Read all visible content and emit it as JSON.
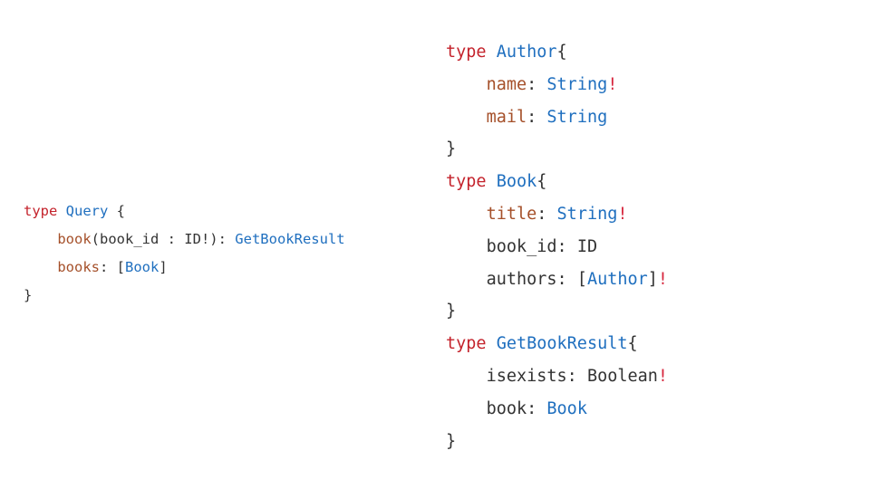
{
  "colors": {
    "keyword": "#c4232c",
    "type": "#1f6fbf",
    "field": "#a5502a",
    "bang": "#d7263d",
    "punct": "#333333",
    "background": "#ffffff"
  },
  "query": {
    "lines": [
      [
        {
          "text": "type",
          "cls": "keyword"
        },
        {
          "text": " ",
          "cls": "punct"
        },
        {
          "text": "Query",
          "cls": "type"
        },
        {
          "text": " {",
          "cls": "punct"
        }
      ],
      [
        {
          "text": "    ",
          "cls": "punct"
        },
        {
          "text": "book",
          "cls": "field"
        },
        {
          "text": "(book_id : ID!): ",
          "cls": "punct"
        },
        {
          "text": "GetBookResult",
          "cls": "type"
        }
      ],
      [
        {
          "text": "    ",
          "cls": "punct"
        },
        {
          "text": "books",
          "cls": "field"
        },
        {
          "text": ": [",
          "cls": "punct"
        },
        {
          "text": "Book",
          "cls": "type"
        },
        {
          "text": "]",
          "cls": "punct"
        }
      ],
      [
        {
          "text": "}",
          "cls": "punct"
        }
      ]
    ]
  },
  "types": {
    "lines": [
      [
        {
          "text": "type",
          "cls": "keyword"
        },
        {
          "text": " ",
          "cls": "punct"
        },
        {
          "text": "Author",
          "cls": "type"
        },
        {
          "text": "{",
          "cls": "punct"
        }
      ],
      [
        {
          "text": "    ",
          "cls": "punct"
        },
        {
          "text": "name",
          "cls": "field"
        },
        {
          "text": ": ",
          "cls": "punct"
        },
        {
          "text": "String",
          "cls": "type"
        },
        {
          "text": "!",
          "cls": "bang"
        }
      ],
      [
        {
          "text": "    ",
          "cls": "punct"
        },
        {
          "text": "mail",
          "cls": "field"
        },
        {
          "text": ": ",
          "cls": "punct"
        },
        {
          "text": "String",
          "cls": "type"
        }
      ],
      [
        {
          "text": "}",
          "cls": "punct"
        }
      ],
      [
        {
          "text": "type",
          "cls": "keyword"
        },
        {
          "text": " ",
          "cls": "punct"
        },
        {
          "text": "Book",
          "cls": "type"
        },
        {
          "text": "{",
          "cls": "punct"
        }
      ],
      [
        {
          "text": "    ",
          "cls": "punct"
        },
        {
          "text": "title",
          "cls": "field"
        },
        {
          "text": ": ",
          "cls": "punct"
        },
        {
          "text": "String",
          "cls": "type"
        },
        {
          "text": "!",
          "cls": "bang"
        }
      ],
      [
        {
          "text": "    ",
          "cls": "punct"
        },
        {
          "text": "book_id",
          "cls": "punct"
        },
        {
          "text": ": ",
          "cls": "punct"
        },
        {
          "text": "ID",
          "cls": "punct"
        }
      ],
      [
        {
          "text": "    ",
          "cls": "punct"
        },
        {
          "text": "authors",
          "cls": "punct"
        },
        {
          "text": ": [",
          "cls": "punct"
        },
        {
          "text": "Author",
          "cls": "type"
        },
        {
          "text": "]",
          "cls": "punct"
        },
        {
          "text": "!",
          "cls": "bang"
        }
      ],
      [
        {
          "text": "}",
          "cls": "punct"
        }
      ],
      [
        {
          "text": "type",
          "cls": "keyword"
        },
        {
          "text": " ",
          "cls": "punct"
        },
        {
          "text": "GetBookResult",
          "cls": "type"
        },
        {
          "text": "{",
          "cls": "punct"
        }
      ],
      [
        {
          "text": "    ",
          "cls": "punct"
        },
        {
          "text": "isexists",
          "cls": "punct"
        },
        {
          "text": ": ",
          "cls": "punct"
        },
        {
          "text": "Boolean",
          "cls": "punct"
        },
        {
          "text": "!",
          "cls": "bang"
        }
      ],
      [
        {
          "text": "    ",
          "cls": "punct"
        },
        {
          "text": "book",
          "cls": "punct"
        },
        {
          "text": ": ",
          "cls": "punct"
        },
        {
          "text": "Book",
          "cls": "type"
        }
      ],
      [
        {
          "text": "}",
          "cls": "punct"
        }
      ]
    ]
  }
}
